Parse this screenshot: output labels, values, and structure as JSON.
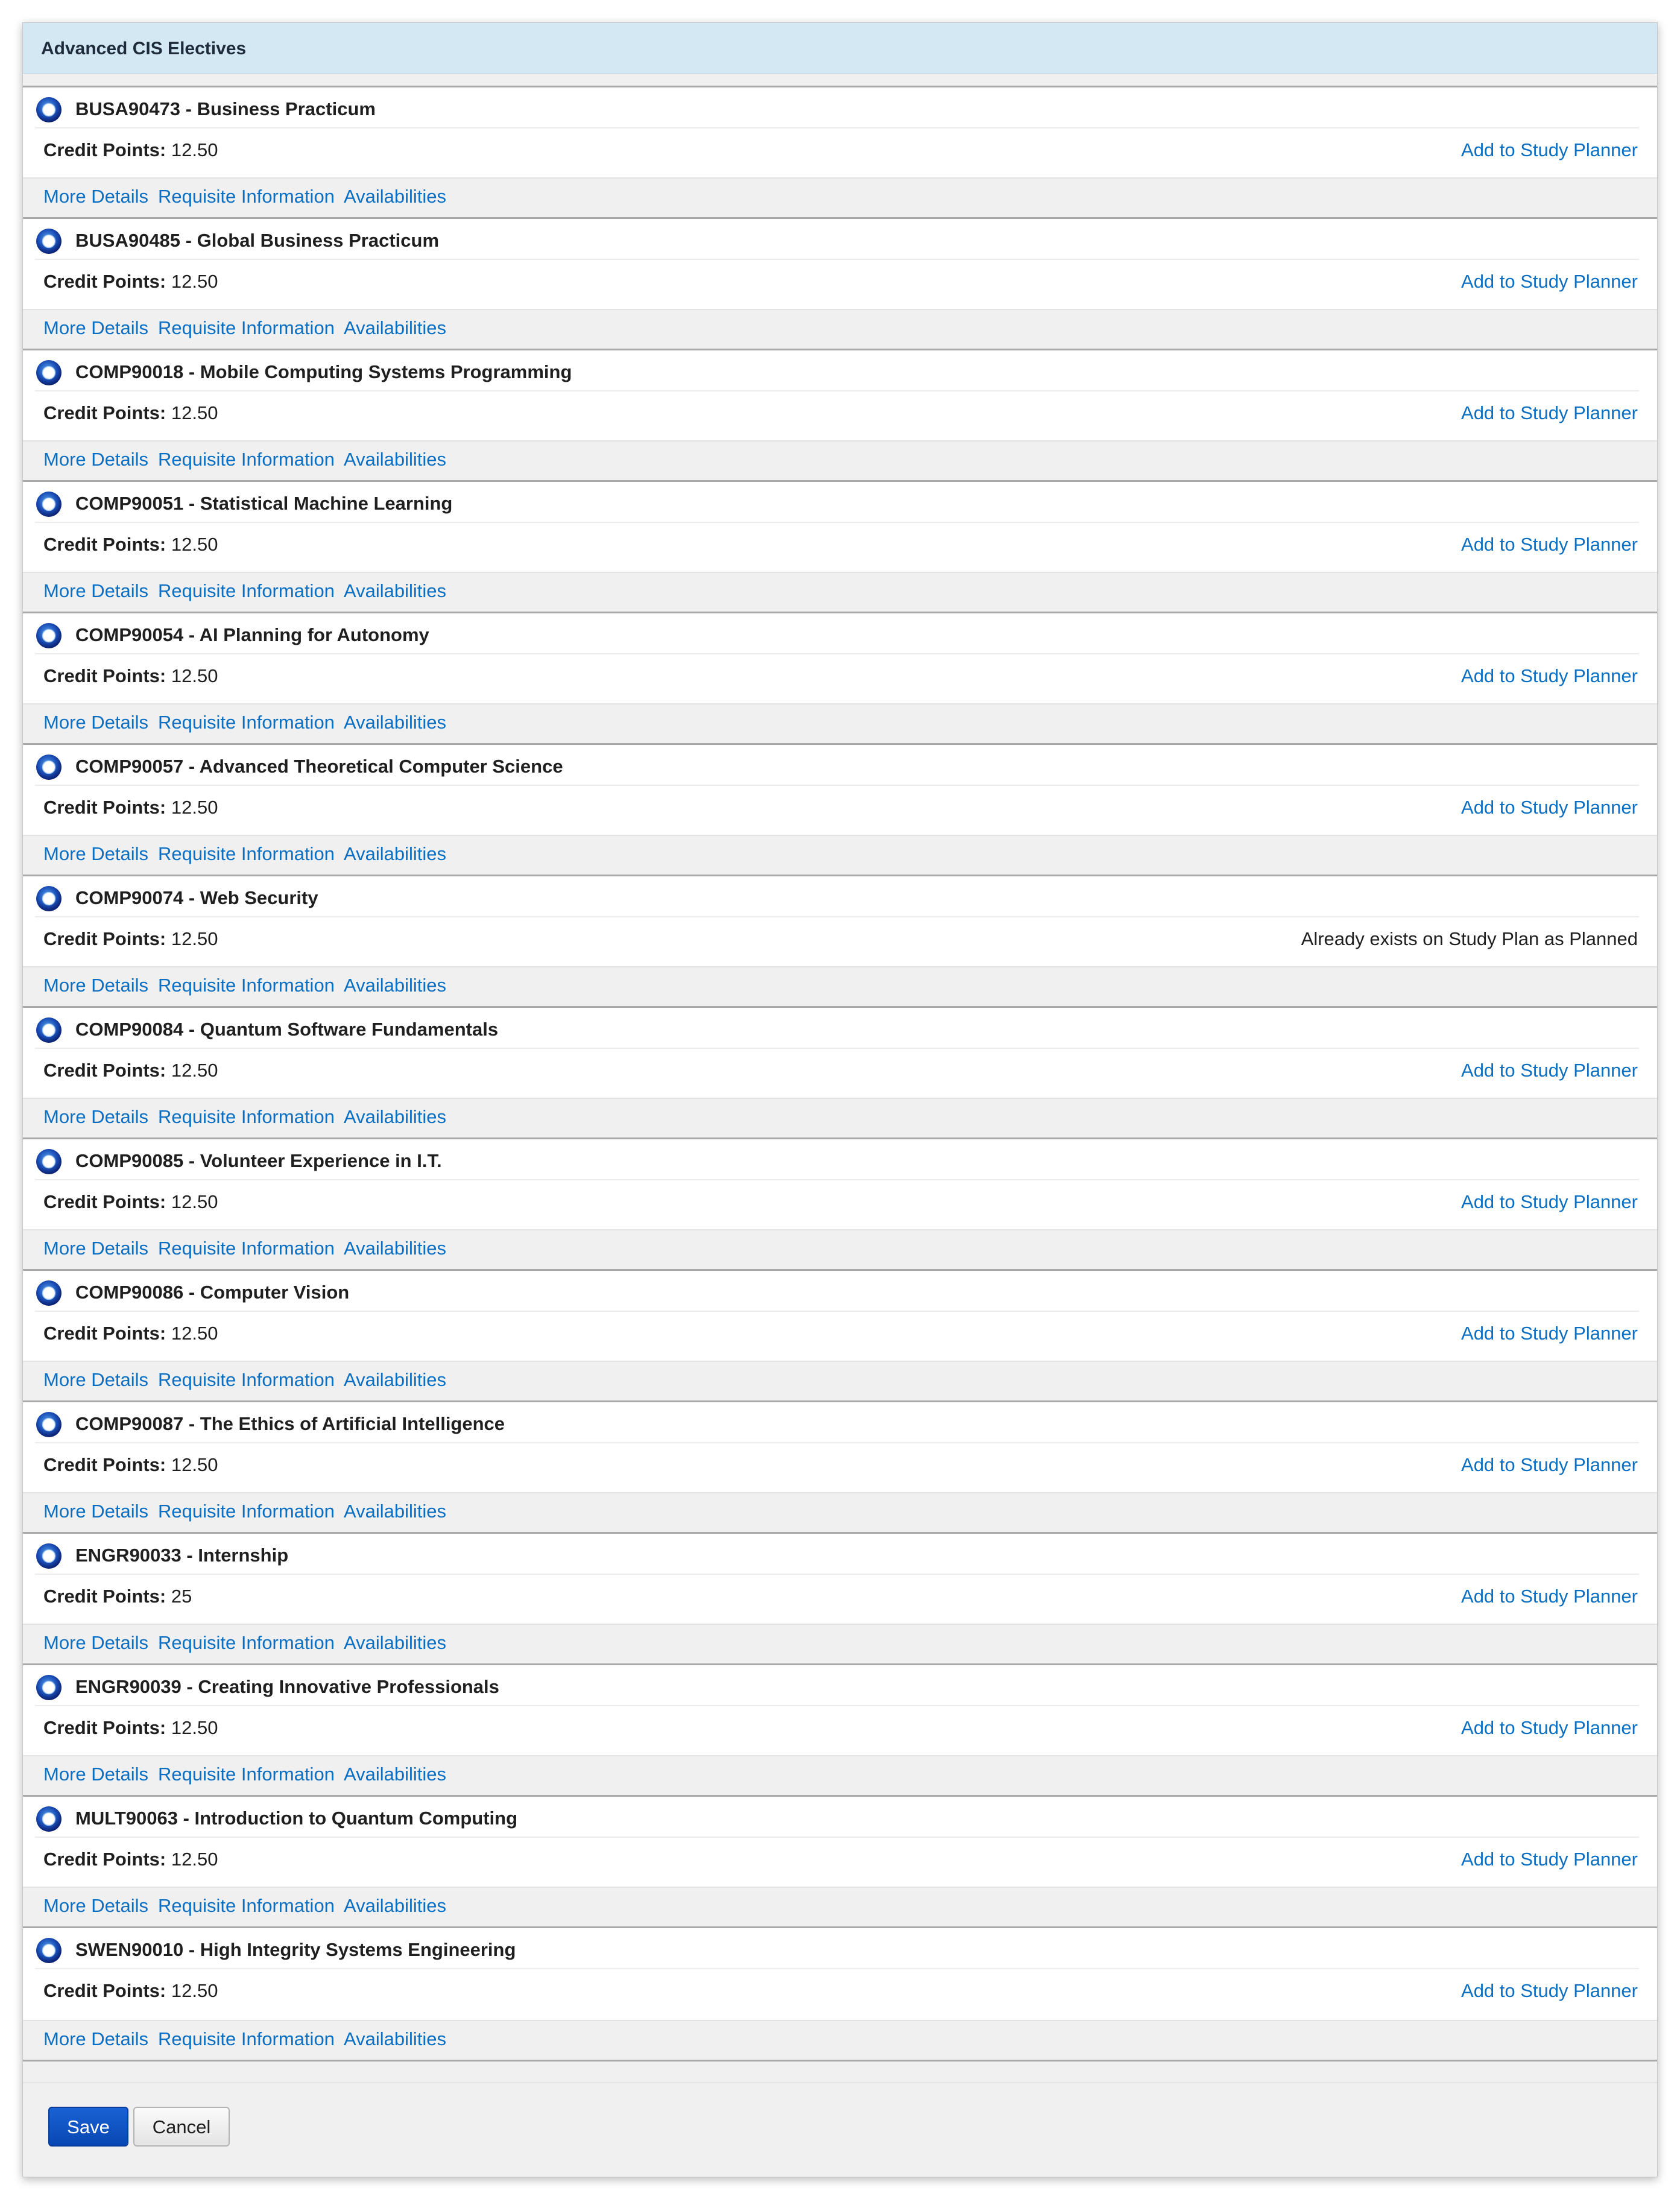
{
  "panel": {
    "title": "Advanced CIS Electives"
  },
  "labels": {
    "credit_points": "Credit Points:",
    "more_details": "More Details",
    "requisite_information": "Requisite Information",
    "availabilities": "Availabilities"
  },
  "items": [
    {
      "title": "BUSA90473 - Business Practicum",
      "credits": "12.50",
      "action": "Add to Study Planner",
      "action_type": "link"
    },
    {
      "title": "BUSA90485 - Global Business Practicum",
      "credits": "12.50",
      "action": "Add to Study Planner",
      "action_type": "link"
    },
    {
      "title": "COMP90018 - Mobile Computing Systems Programming",
      "credits": "12.50",
      "action": "Add to Study Planner",
      "action_type": "link"
    },
    {
      "title": "COMP90051 - Statistical Machine Learning",
      "credits": "12.50",
      "action": "Add to Study Planner",
      "action_type": "link"
    },
    {
      "title": "COMP90054 - AI Planning for Autonomy",
      "credits": "12.50",
      "action": "Add to Study Planner",
      "action_type": "link"
    },
    {
      "title": "COMP90057 - Advanced Theoretical Computer Science",
      "credits": "12.50",
      "action": "Add to Study Planner",
      "action_type": "link"
    },
    {
      "title": "COMP90074 - Web Security",
      "credits": "12.50",
      "action": "Already exists on Study Plan as Planned",
      "action_type": "status"
    },
    {
      "title": "COMP90084 - Quantum Software Fundamentals",
      "credits": "12.50",
      "action": "Add to Study Planner",
      "action_type": "link"
    },
    {
      "title": "COMP90085 - Volunteer Experience in I.T.",
      "credits": "12.50",
      "action": "Add to Study Planner",
      "action_type": "link"
    },
    {
      "title": "COMP90086 - Computer Vision",
      "credits": "12.50",
      "action": "Add to Study Planner",
      "action_type": "link"
    },
    {
      "title": "COMP90087 - The Ethics of Artificial Intelligence",
      "credits": "12.50",
      "action": "Add to Study Planner",
      "action_type": "link"
    },
    {
      "title": "ENGR90033 - Internship",
      "credits": "25",
      "action": "Add to Study Planner",
      "action_type": "link"
    },
    {
      "title": "ENGR90039 - Creating Innovative Professionals",
      "credits": "12.50",
      "action": "Add to Study Planner",
      "action_type": "link"
    },
    {
      "title": "MULT90063 - Introduction to Quantum Computing",
      "credits": "12.50",
      "action": "Add to Study Planner",
      "action_type": "link"
    },
    {
      "title": "SWEN90010 - High Integrity Systems Engineering",
      "credits": "12.50",
      "action": "Add to Study Planner",
      "action_type": "link"
    }
  ],
  "buttons": {
    "save": "Save",
    "cancel": "Cancel"
  },
  "icons": {
    "unit": "radio-ring-icon"
  },
  "colors": {
    "link": "#0a6fc2",
    "header_bg": "#d4e8f4",
    "save_bg": "#0c4fc0"
  }
}
